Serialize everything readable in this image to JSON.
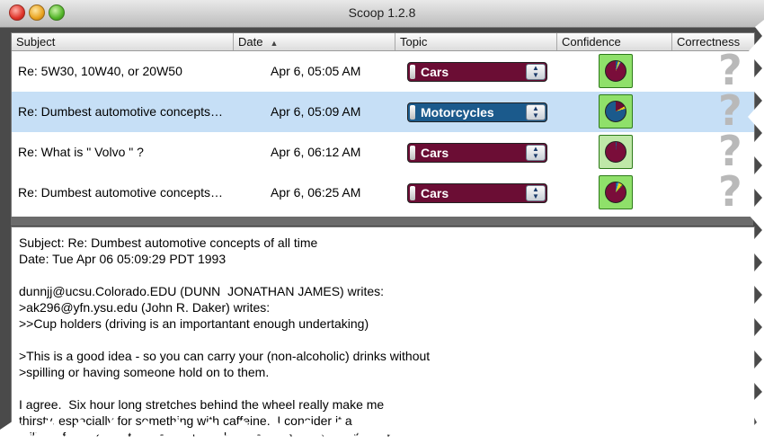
{
  "window": {
    "title": "Scoop 1.2.8"
  },
  "columns": {
    "subject": "Subject",
    "date": "Date",
    "topic": "Topic",
    "confidence": "Confidence",
    "correctness": "Correctness"
  },
  "messages": [
    {
      "subject": "Re: 5W30, 10W40, or 20W50",
      "date": "Apr 6, 05:05 AM",
      "topic": "Cars",
      "correctness": "?"
    },
    {
      "subject": "Re: Dumbest automotive concepts…",
      "date": "Apr 6, 05:09 AM",
      "topic": "Motorcycles",
      "correctness": "?"
    },
    {
      "subject": "Re: What is \" Volvo \" ?",
      "date": "Apr 6, 06:12 AM",
      "topic": "Cars",
      "correctness": "?"
    },
    {
      "subject": "Re: Dumbest automotive concepts…",
      "date": "Apr 6, 06:25 AM",
      "topic": "Cars",
      "correctness": "?"
    }
  ],
  "preview": {
    "text": "Subject: Re: Dumbest automotive concepts of all time\nDate: Tue Apr 06 05:09:29 PDT 1993\n\ndunnjj@ucsu.Colorado.EDU (DUNN  JONATHAN JAMES) writes:\n>ak296@yfn.ysu.edu (John R. Daker) writes:\n>>Cup holders (driving is an importantant enough undertaking)\n\n>This is a good idea - so you can carry your (non-alcoholic) drinks without\n>spilling or having someone hold on to them.\n\nI agree.  Six hour long stretches behind the wheel really make me\nthirsty, especially for something with caffeine.  I consider it a\nfailing of my car that it has no cup holder nor anywhere to put a cup\nholder."
  },
  "colors": {
    "cars": "#6b0d34",
    "motorcycles": "#1b5a8c",
    "selection": "#c6dff6"
  }
}
